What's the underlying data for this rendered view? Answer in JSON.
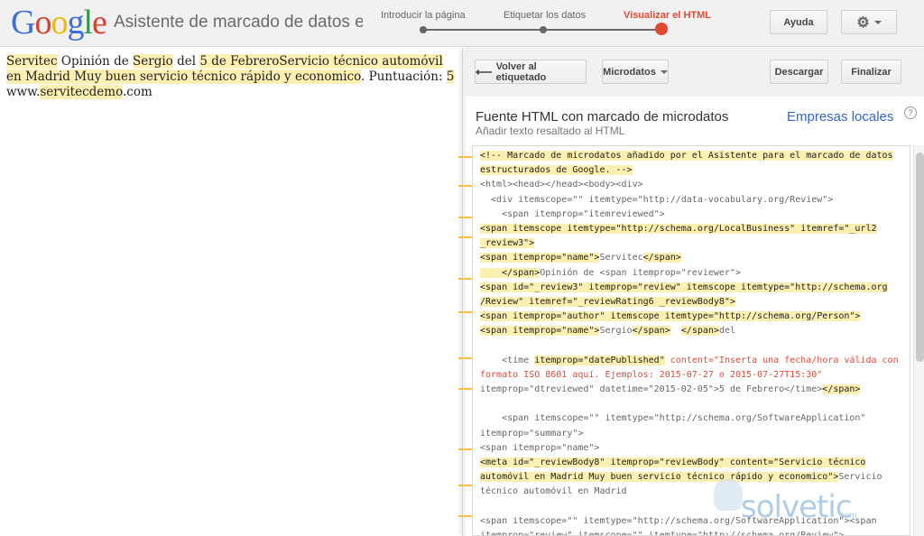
{
  "header": {
    "logo": [
      "G",
      "o",
      "o",
      "g",
      "l",
      "e"
    ],
    "app_title": "Asistente de marcado de datos estructurados",
    "steps": [
      {
        "label": "Introducir la página",
        "state": "done"
      },
      {
        "label": "Etiquetar los datos",
        "state": "done"
      },
      {
        "label": "Visualizar el HTML",
        "state": "active"
      }
    ],
    "help_label": "Ayuda",
    "settings_icon": "gear-icon"
  },
  "document": {
    "segments": [
      {
        "t": "Servitec",
        "h": true
      },
      {
        "t": " Opinión de ",
        "h": false
      },
      {
        "t": "Sergio",
        "h": true
      },
      {
        "t": " del ",
        "h": false
      },
      {
        "t": "5 de Febrero",
        "h": true
      },
      {
        "t": "Servicio técnico automóvil en Madrid Muy buen servicio técnico rápido y economico",
        "h": true
      },
      {
        "t": ". Puntuación: ",
        "h": false
      },
      {
        "t": "5",
        "h": true
      },
      {
        "t": " www.",
        "h": false
      },
      {
        "t": "servitecdemo",
        "h": true
      },
      {
        "t": ".com",
        "h": false
      }
    ]
  },
  "panel": {
    "back_label": "Volver al etiquetado",
    "format_label": "Microdatos",
    "download_label": "Descargar",
    "finish_label": "Finalizar",
    "title": "Fuente HTML con marcado de microdatos",
    "subtitle": "Añadir texto resaltado al HTML",
    "link": "Empresas locales",
    "help_icon": "?",
    "code_lines": [
      [
        {
          "t": "<!-- Marcado de microdatos añadido por el Asistente para el marcado de datos",
          "c": "hl"
        }
      ],
      [
        {
          "t": "estructurados de Google. -->",
          "c": "hl"
        }
      ],
      [
        {
          "t": "<html><head></head><body><div>",
          "c": ""
        }
      ],
      [
        {
          "t": "  <div itemscope=\"\" itemtype=\"http://data-vocabulary.org/Review\">",
          "c": ""
        }
      ],
      [
        {
          "t": "    <span itemprop=\"itemreviewed\">",
          "c": ""
        }
      ],
      [
        {
          "t": "<span itemscope itemtype=\"http://schema.org/LocalBusiness\" itemref=\"_url2",
          "c": "hl"
        }
      ],
      [
        {
          "t": "_review3\">",
          "c": "hl"
        }
      ],
      [
        {
          "t": "<span itemprop=\"name\">",
          "c": "hl"
        },
        {
          "t": "Servitec",
          "c": ""
        },
        {
          "t": "</span>",
          "c": "hl"
        }
      ],
      [
        {
          "t": "    </span>",
          "c": "hl"
        },
        {
          "t": "Opinión de <span itemprop=\"reviewer\">",
          "c": ""
        }
      ],
      [
        {
          "t": "<span id=\"_review3\" itemprop=\"review\" itemscope itemtype=\"http://schema.org",
          "c": "hl"
        }
      ],
      [
        {
          "t": "/Review\" itemref=\"_reviewRating6 _reviewBody8\">",
          "c": "hl"
        }
      ],
      [
        {
          "t": "<span itemprop=\"author\" itemscope itemtype=\"http://schema.org/Person\">",
          "c": "hl"
        }
      ],
      [
        {
          "t": "<span itemprop=\"name\">",
          "c": "hl"
        },
        {
          "t": "Sergio",
          "c": ""
        },
        {
          "t": "</span>",
          "c": "hl"
        },
        {
          "t": "  ",
          "c": ""
        },
        {
          "t": "</span>",
          "c": "hl"
        },
        {
          "t": "del",
          "c": ""
        }
      ],
      [
        {
          "t": "",
          "c": ""
        }
      ],
      [
        {
          "t": "    <time ",
          "c": ""
        },
        {
          "t": "itemprop=\"datePublished\"",
          "c": "hl"
        },
        {
          "t": " content=\"Inserta una fecha/hora válida con",
          "c": "red"
        }
      ],
      [
        {
          "t": "formato ISO 8601 aquí. Ejemplos: 2015-07-27 o 2015-07-27T15:30\"",
          "c": "red"
        }
      ],
      [
        {
          "t": "itemprop=\"dtreviewed\" datetime=\"2015-02-05\">5 de Febrero</time>",
          "c": ""
        },
        {
          "t": "</span>",
          "c": "hl"
        }
      ],
      [
        {
          "t": "",
          "c": ""
        }
      ],
      [
        {
          "t": "    <span itemscope=\"\" itemtype=\"http://schema.org/SoftwareApplication\"",
          "c": ""
        }
      ],
      [
        {
          "t": "itemprop=\"summary\">",
          "c": ""
        }
      ],
      [
        {
          "t": "<span itemprop=\"name\">",
          "c": ""
        }
      ],
      [
        {
          "t": "<meta id=\"_reviewBody8\" itemprop=\"reviewBody\" content=\"Servicio técnico",
          "c": "hl"
        }
      ],
      [
        {
          "t": "automóvil en Madrid Muy buen servicio técnico rápido y economico\">",
          "c": "hl"
        },
        {
          "t": "Servicio",
          "c": ""
        }
      ],
      [
        {
          "t": "técnico automóvil en Madrid",
          "c": ""
        }
      ],
      [
        {
          "t": "",
          "c": ""
        }
      ],
      [
        {
          "t": "<span itemscope=\"\" itemtype=\"http://schema.org/SoftwareApplication\"><span",
          "c": ""
        }
      ],
      [
        {
          "t": "itemprop=\"review\" itemscope=\"\" itemtype=\"http://schema.org/Review\">",
          "c": ""
        }
      ]
    ]
  },
  "watermark": {
    "text": "solvetic",
    "suffix": ".com"
  }
}
